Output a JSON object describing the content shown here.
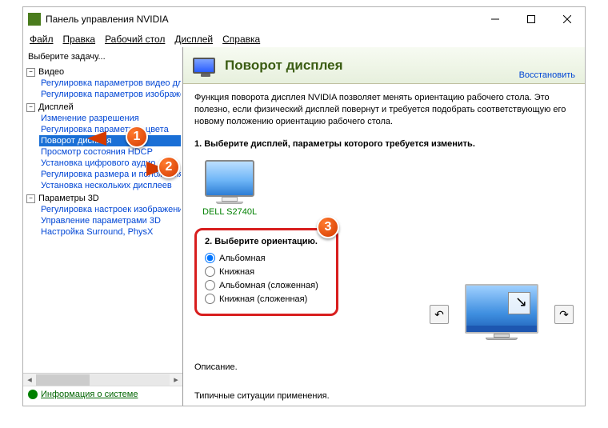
{
  "window": {
    "title": "Панель управления NVIDIA"
  },
  "menu": {
    "file": "Файл",
    "edit": "Правка",
    "desktop": "Рабочий стол",
    "display": "Дисплей",
    "help": "Справка"
  },
  "sidebar": {
    "select_task": "Выберите задачу...",
    "groups": [
      {
        "label": "Видео",
        "items": [
          "Регулировка параметров видео для вид",
          "Регулировка параметров изображения д"
        ]
      },
      {
        "label": "Дисплей",
        "items": [
          "Изменение разрешения",
          "Регулировка параметров цвета",
          "Поворот дисплея",
          "Просмотр состояния HDCP",
          "Установка цифрового аудио",
          "Регулировка размера и положения рабо",
          "Установка нескольких дисплеев"
        ],
        "selected_index": 2
      },
      {
        "label": "Параметры 3D",
        "items": [
          "Регулировка настроек изображения с пр",
          "Управление параметрами 3D",
          "Настройка Surround, PhysX"
        ]
      }
    ],
    "sys_info": "Информация о системе"
  },
  "main": {
    "banner_title": "Поворот дисплея",
    "restore": "Восстановить",
    "description": "Функция поворота дисплея NVIDIA позволяет менять ориентацию рабочего стола. Это полезно, если физический дисплей повернут и требуется подобрать соответствующую его новому положению ориентацию рабочего стола.",
    "step1_title": "1. Выберите дисплей, параметры которого требуется изменить.",
    "monitor_name": "DELL S2740L",
    "step2_title": "2. Выберите ориентацию.",
    "orientations": [
      "Альбомная",
      "Книжная",
      "Альбомная (сложенная)",
      "Книжная (сложенная)"
    ],
    "selected_orientation": 0,
    "desc_heading": "Описание.",
    "typical_heading": "Типичные ситуации применения."
  },
  "callouts": {
    "one": "1",
    "two": "2",
    "three": "3"
  }
}
